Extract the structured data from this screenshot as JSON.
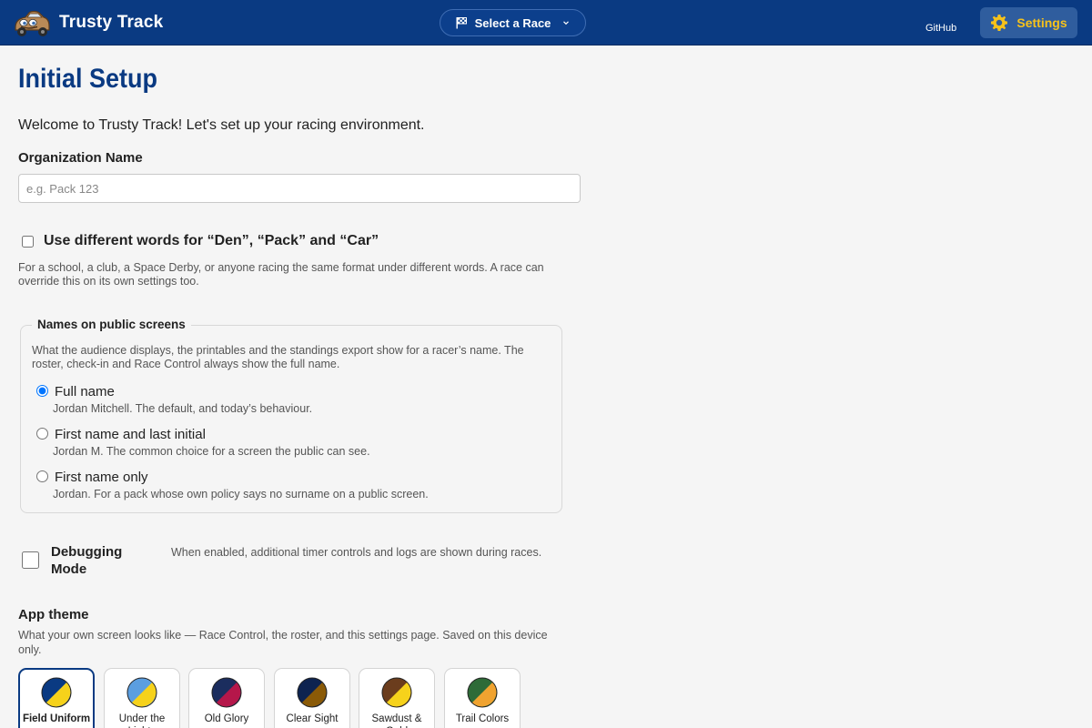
{
  "header": {
    "app_name": "Trusty Track",
    "race_select_label": "Select a Race",
    "github_label": "GitHub",
    "settings_label": "Settings"
  },
  "main": {
    "title": "Initial Setup",
    "welcome": "Welcome to Trusty Track! Let's set up your racing environment.",
    "org": {
      "label": "Organization Name",
      "placeholder": "e.g. Pack 123",
      "value": ""
    },
    "alt_words": {
      "label": "Use different words for “Den”, “Pack” and “Car”",
      "checked": false,
      "help": "For a school, a club, a Space Derby, or anyone racing the same format under different words. A race can override this on its own settings too."
    },
    "public_names": {
      "legend": "Names on public screens",
      "help": "What the audience displays, the printables and the standings export show for a racer’s name. The roster, check-in and Race Control always show the full name.",
      "options": [
        {
          "label": "Full name",
          "desc": "Jordan Mitchell. The default, and today’s behaviour.",
          "selected": true
        },
        {
          "label": "First name and last initial",
          "desc": "Jordan M. The common choice for a screen the public can see.",
          "selected": false
        },
        {
          "label": "First name only",
          "desc": "Jordan. For a pack whose own policy says no surname on a public screen.",
          "selected": false
        }
      ]
    },
    "debug": {
      "label": "Debugging Mode",
      "checked": false,
      "help": "When enabled, additional timer controls and logs are shown during races."
    },
    "theme": {
      "title": "App theme",
      "help": "What your own screen looks like — Race Control, the roster, and this settings page. Saved on this device only.",
      "options": [
        {
          "name": "Field Uniform",
          "colors": [
            "#0a3a82",
            "#f6d21b"
          ],
          "selected": true
        },
        {
          "name": "Under the Lights",
          "colors": [
            "#5b9ee0",
            "#f6d21b"
          ],
          "selected": false
        },
        {
          "name": "Old Glory",
          "colors": [
            "#1b2d5e",
            "#b5174a"
          ],
          "selected": false
        },
        {
          "name": "Clear Sight",
          "colors": [
            "#0d2350",
            "#8a5a07"
          ],
          "selected": false
        },
        {
          "name": "Sawdust & Gold",
          "colors": [
            "#6b3d1d",
            "#f6d21b"
          ],
          "selected": false
        },
        {
          "name": "Trail Colors",
          "colors": [
            "#2e6b38",
            "#f0a330"
          ],
          "selected": false
        }
      ]
    }
  },
  "colors": {
    "header_bg": "#0a3a82",
    "accent_yellow": "#f6c21b",
    "title_blue": "#0a3a82"
  },
  "icons": {
    "logo": "car-mascot-icon",
    "race_select": "checkered-flag-icon",
    "dropdown": "chevron-down-icon",
    "settings": "gear-icon"
  }
}
